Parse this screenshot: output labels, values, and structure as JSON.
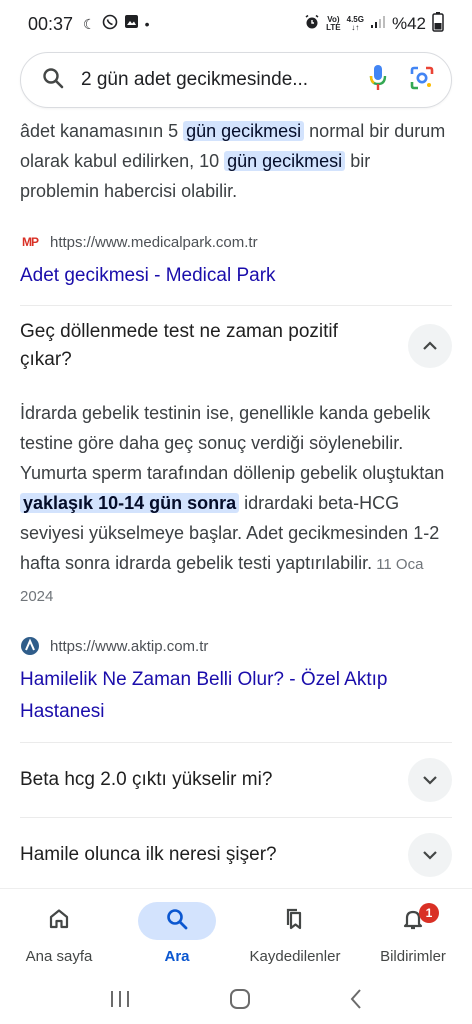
{
  "status": {
    "time": "00:37",
    "battery": "%42",
    "net_top": "Vo)",
    "net_bottom": "LTE",
    "gen": "4.5G"
  },
  "search": {
    "query": "2 gün adet gecikmesinde..."
  },
  "snippet1": {
    "t1": "âdet kanamasının 5 ",
    "h1": "gün gecikmesi",
    "t2": " normal bir durum olarak kabul edilirken, 10 ",
    "h2": "gün gecikmesi",
    "t3": " bir problemin habercisi olabilir.",
    "source_url": "https://www.medicalpark.com.tr",
    "favicon": "MP",
    "link": "Adet gecikmesi - Medical Park"
  },
  "faq1": {
    "question": "Geç döllenmede test ne zaman pozitif çıkar?",
    "t1": "İdrarda gebelik testinin ise, genellikle kanda gebelik testine göre daha geç sonuç verdiği söylenebilir. Yumurta sperm tarafından döllenip gebelik oluştuktan ",
    "h1": "yaklaşık 10-14 gün sonra",
    "t2": " idrardaki beta-HCG seviyesi yükselmeye başlar. Adet gecikmesinden 1-2 hafta sonra idrarda gebelik testi yaptırılabilir.",
    "date": "11 Oca 2024",
    "source_url": "https://www.aktip.com.tr",
    "link": "Hamilelik Ne Zaman Belli Olur? - Özel Aktıp Hastanesi"
  },
  "faq2": {
    "question": "Beta hcg 2.0 çıktı yükselir mi?"
  },
  "faq3": {
    "question": "Hamile olunca ilk neresi şişer?"
  },
  "nav": {
    "home": "Ana sayfa",
    "search": "Ara",
    "saved": "Kaydedilenler",
    "notifications": "Bildirimler",
    "badge": "1"
  },
  "colors": {
    "accent": "#0b57d0",
    "highlight": "#d3e3fd",
    "link": "#1a0dab"
  }
}
